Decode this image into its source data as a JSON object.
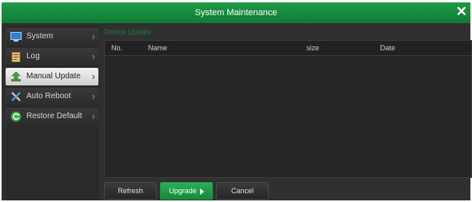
{
  "window": {
    "title": "System Maintenance"
  },
  "sidebar": {
    "items": [
      {
        "label": "System",
        "icon": "monitor-icon"
      },
      {
        "label": "Log",
        "icon": "clipboard-icon"
      },
      {
        "label": "Manual Update",
        "icon": "update-arrow-icon",
        "active": true
      },
      {
        "label": "Auto Reboot",
        "icon": "tools-icon"
      },
      {
        "label": "Restore Default",
        "icon": "refresh-circle-icon"
      }
    ]
  },
  "main": {
    "device_label": "Device Update",
    "columns": [
      "No.",
      "Name",
      "size",
      "Date"
    ],
    "rows": []
  },
  "buttons": {
    "refresh": "Refresh",
    "upgrade": "Upgrade",
    "cancel": "Cancel"
  },
  "colors": {
    "accent": "#149a45"
  }
}
